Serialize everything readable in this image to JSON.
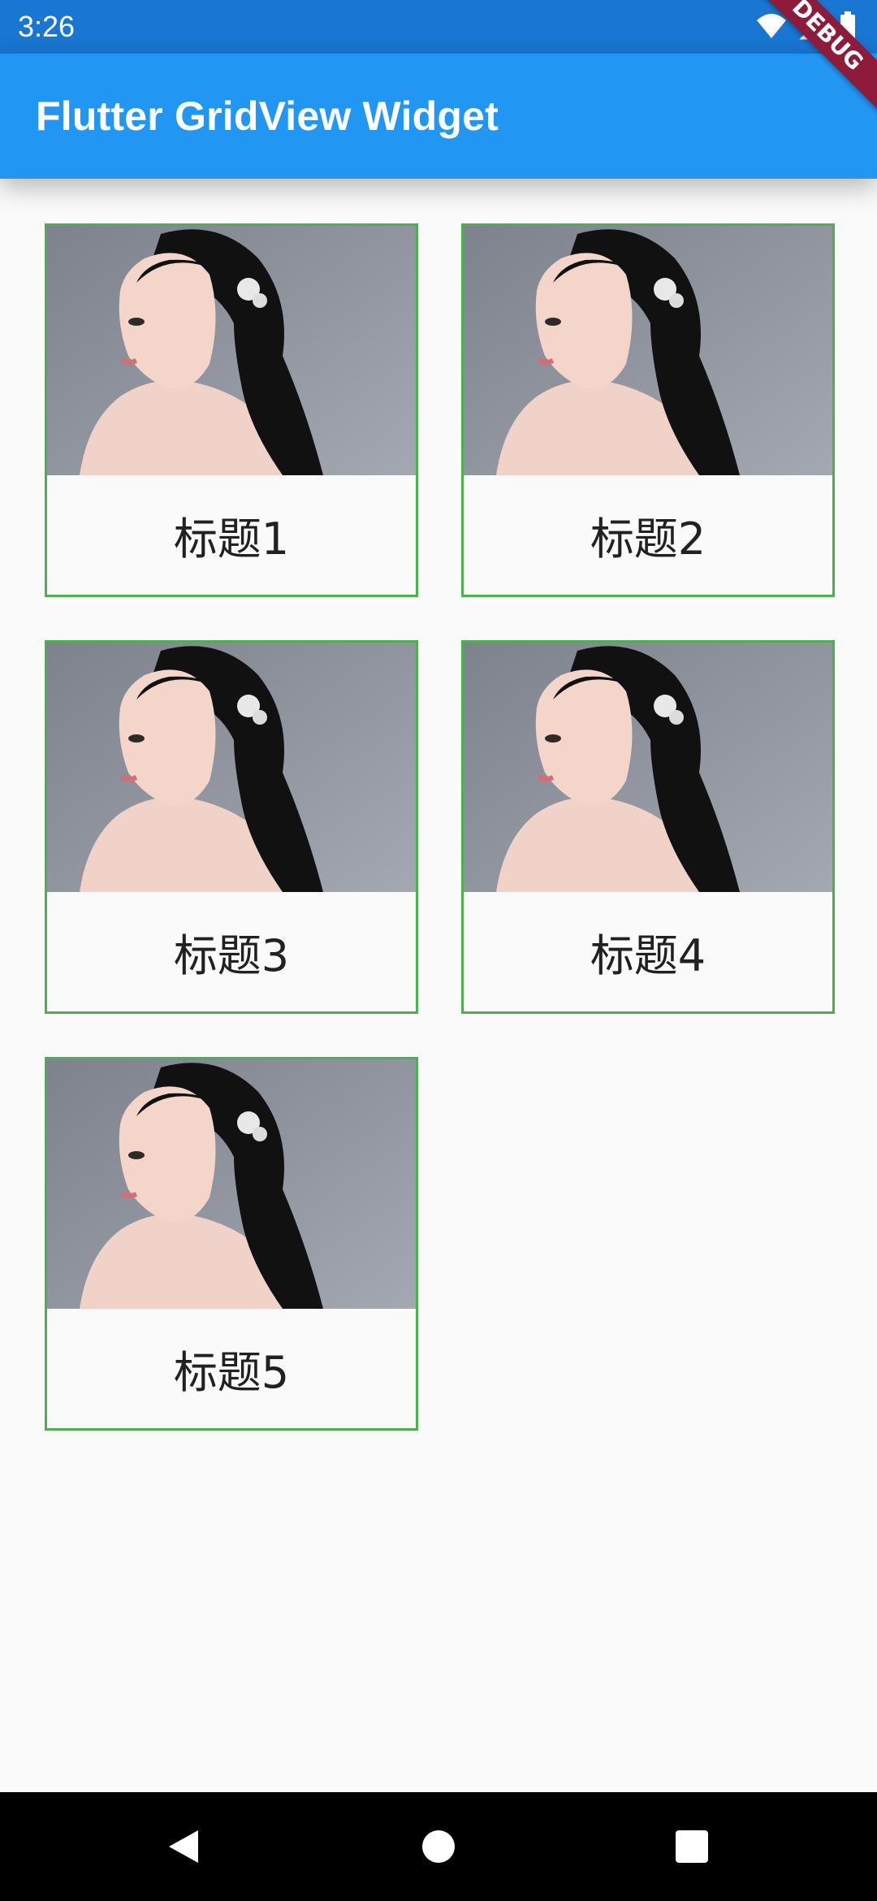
{
  "status_bar": {
    "time": "3:26",
    "icons": [
      "wifi-icon",
      "signal-icon",
      "battery-icon"
    ],
    "background": "#1976d2"
  },
  "app_bar": {
    "title": "Flutter GridView Widget",
    "background": "#2196f3",
    "debug_banner": "DEBUG"
  },
  "grid": {
    "border_color": "#4caf50",
    "items": [
      {
        "title": "标题1",
        "image": "portrait-photo"
      },
      {
        "title": "标题2",
        "image": "portrait-photo"
      },
      {
        "title": "标题3",
        "image": "portrait-photo"
      },
      {
        "title": "标题4",
        "image": "portrait-photo"
      },
      {
        "title": "标题5",
        "image": "portrait-photo"
      }
    ]
  },
  "nav_bar": {
    "buttons": [
      "back-icon",
      "home-icon",
      "recents-icon"
    ]
  }
}
